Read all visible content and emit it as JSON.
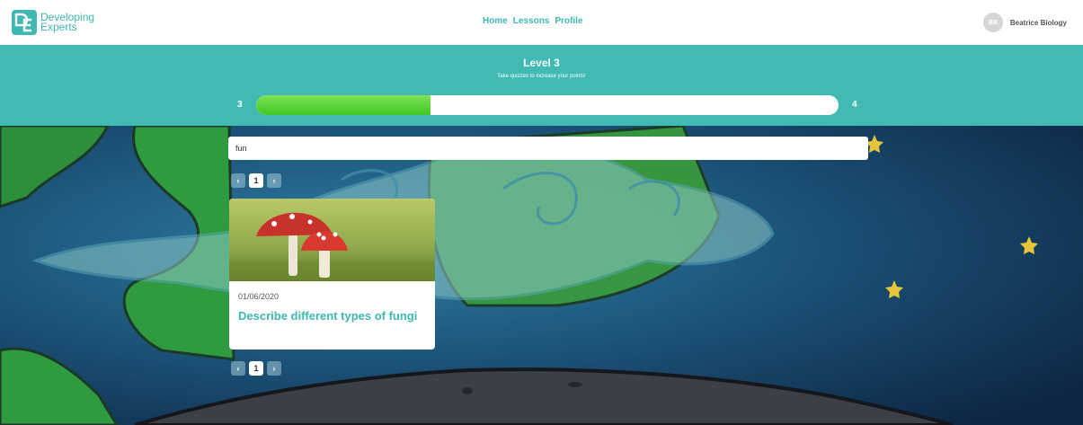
{
  "header": {
    "logo_line1": "Developing",
    "logo_line2": "Experts",
    "nav": [
      "Home",
      "Lessons",
      "Profile"
    ],
    "user_initials": "BB",
    "user_name": "Beatrice Biology"
  },
  "level": {
    "title": "Level 3",
    "subtitle": "Take quizzes to increase your points!",
    "current": "3",
    "next": "4",
    "progress_fraction": 0.3
  },
  "search": {
    "value": "fun"
  },
  "pagination": {
    "prev": "‹",
    "page": "1",
    "next": "›"
  },
  "lessons": [
    {
      "date": "01/06/2020",
      "title": "Describe different types of fungi"
    }
  ],
  "colors": {
    "brand": "#3eb8b0",
    "banner": "#40bab3",
    "progress": "#4fd332"
  }
}
